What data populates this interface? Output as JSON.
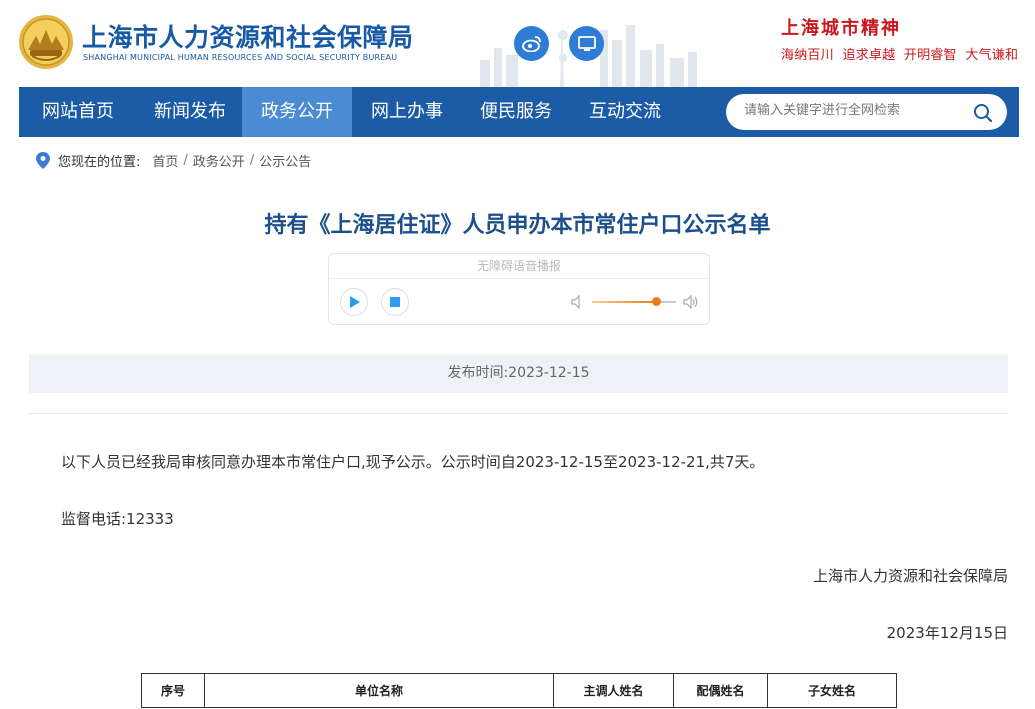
{
  "header": {
    "org_name_cn": "上海市人力资源和社会保障局",
    "org_name_en": "SHANGHAI MUNICIPAL HUMAN RESOURCES AND SOCIAL SECURITY BUREAU",
    "city_spirit_title": "上海城市精神",
    "city_spirit_slogan": "海纳百川  追求卓越  开明睿智  大气谦和",
    "icons": [
      "weibo-icon",
      "monitor-icon"
    ]
  },
  "nav": {
    "items": [
      {
        "label": "网站首页"
      },
      {
        "label": "新闻发布"
      },
      {
        "label": "政务公开"
      },
      {
        "label": "网上办事"
      },
      {
        "label": "便民服务"
      },
      {
        "label": "互动交流"
      }
    ],
    "active_index": 2,
    "search_placeholder": "请输入关键字进行全网检索"
  },
  "breadcrumb": {
    "prefix": "您现在的位置:",
    "items": [
      "首页",
      "政务公开",
      "公示公告"
    ],
    "separator": "/"
  },
  "article": {
    "title": "持有《上海居住证》人员申办本市常住户口公示名单",
    "player": {
      "label": "无障碍语音播报",
      "volume_level": 0.76
    },
    "publish_time_label": "发布时间:",
    "publish_time": "2023-12-15",
    "intro": "以下人员已经我局审核同意办理本市常住户口,现予公示。公示时间自2023-12-15至2023-12-21,共7天。",
    "hotline": "监督电话:12333",
    "signature": "上海市人力资源和社会保障局",
    "date": "2023年12月15日",
    "table": {
      "columns": [
        "序号",
        "单位名称",
        "主调人姓名",
        "配偶姓名",
        "子女姓名"
      ]
    }
  },
  "colors": {
    "nav_bg": "#1c5ca6",
    "nav_active": "#4a8bd4",
    "title": "#1c4f8c",
    "spirit_red": "#c8181e",
    "slider_accent": "#f07a16"
  }
}
